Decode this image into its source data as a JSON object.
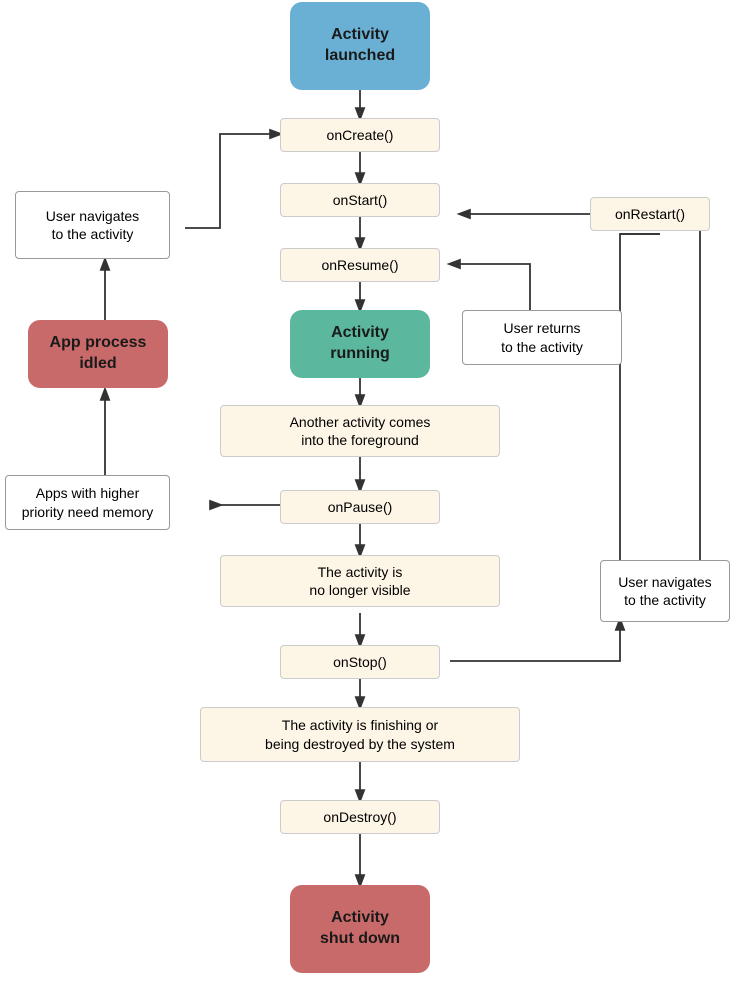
{
  "nodes": {
    "activity_launched": {
      "label": "Activity\nlaunched"
    },
    "on_create": {
      "label": "onCreate()"
    },
    "on_start": {
      "label": "onStart()"
    },
    "on_resume": {
      "label": "onResume()"
    },
    "activity_running": {
      "label": "Activity\nrunning"
    },
    "another_activity": {
      "label": "Another activity comes\ninto the foreground"
    },
    "on_pause": {
      "label": "onPause()"
    },
    "no_longer_visible": {
      "label": "The activity is\nno longer visible"
    },
    "on_stop": {
      "label": "onStop()"
    },
    "finishing": {
      "label": "The activity is finishing or\nbeing destroyed by the system"
    },
    "on_destroy": {
      "label": "onDestroy()"
    },
    "activity_shutdown": {
      "label": "Activity\nshut down"
    },
    "user_navigates_1": {
      "label": "User navigates\nto the activity"
    },
    "app_process_idled": {
      "label": "App process\nidled"
    },
    "apps_higher_priority": {
      "label": "Apps with higher\npriority need memory"
    },
    "user_returns": {
      "label": "User returns\nto the activity"
    },
    "on_restart": {
      "label": "onRestart()"
    },
    "user_navigates_2": {
      "label": "User navigates\nto the activity"
    }
  }
}
